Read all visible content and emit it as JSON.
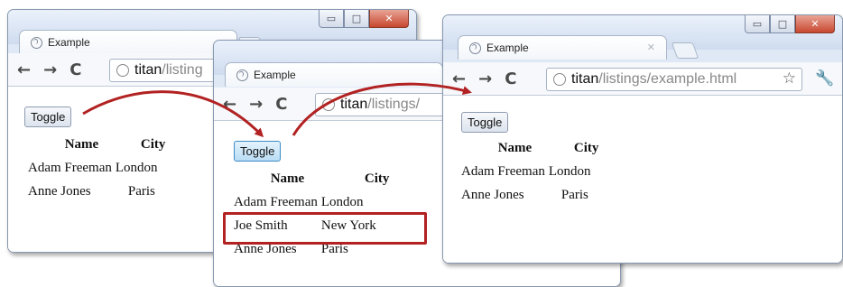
{
  "accent_red": "#b22222",
  "tab_title": "Example",
  "url_host": "titan",
  "url_path": "/listings/example.html",
  "icons": {
    "back": "←",
    "forward": "→",
    "reload": "C",
    "star": "☆",
    "wrench": "🔧",
    "close": "✕",
    "min": "▭",
    "max": "□"
  },
  "toggle_label": "Toggle",
  "columns": [
    "Name",
    "City"
  ],
  "win1": {
    "url_path": "/listing",
    "rows": [
      [
        "Adam Freeman",
        "London"
      ],
      [
        "Anne Jones",
        "Paris"
      ]
    ]
  },
  "win2": {
    "url_path": "/listings/",
    "rows": [
      [
        "Adam Freeman",
        "London"
      ],
      [
        "Joe Smith",
        "New York"
      ],
      [
        "Anne Jones",
        "Paris"
      ]
    ]
  },
  "win3": {
    "url_path": "/listings/example.html",
    "rows": [
      [
        "Adam Freeman",
        "London"
      ],
      [
        "Anne Jones",
        "Paris"
      ]
    ]
  }
}
